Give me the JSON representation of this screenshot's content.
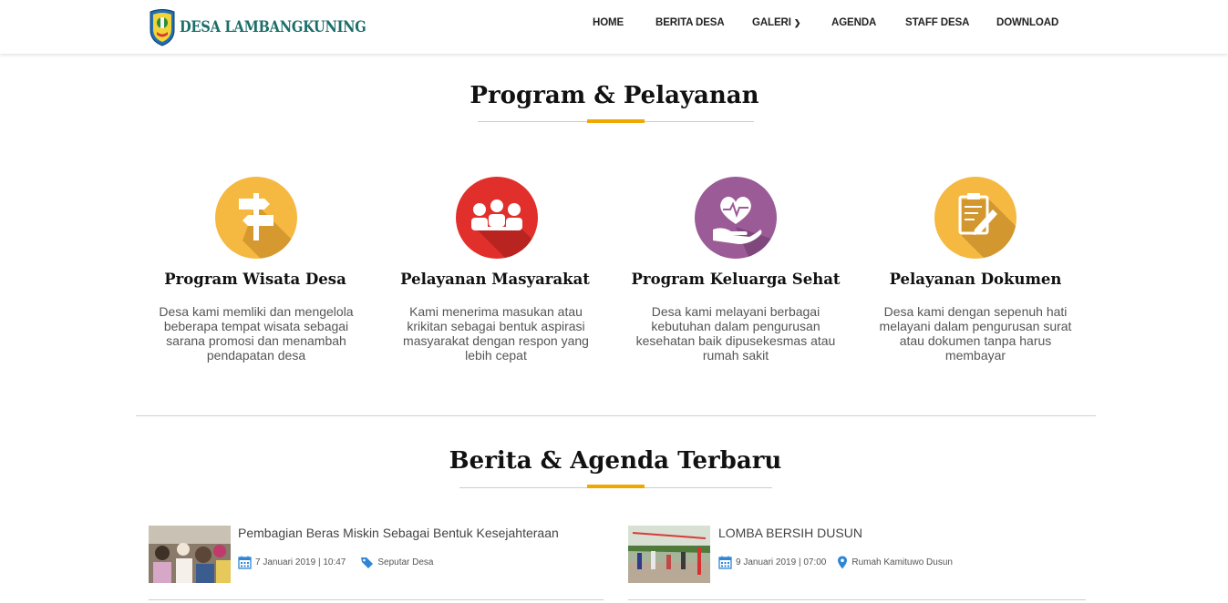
{
  "brand": {
    "name": "DESA LAMBANGKUNING"
  },
  "nav": {
    "home": "HOME",
    "berita": "BERITA DESA",
    "galeri": "GALERI",
    "agenda": "AGENDA",
    "staff": "STAFF DESA",
    "download": "DOWNLOAD"
  },
  "program": {
    "title": "Program & Pelayanan",
    "items": [
      {
        "name": "Program Wisata Desa",
        "desc": "Desa kami memliki dan mengelola beberapa tempat wisata sebagai sarana promosi dan menambah pendapatan desa",
        "icon": "signpost-icon",
        "color": "#f5b942"
      },
      {
        "name": "Pelayanan Masyarakat",
        "desc": "Kami menerima masukan atau krikitan sebagai bentuk aspirasi masyarakat dengan respon yang lebih cepat",
        "icon": "people-meeting-icon",
        "color": "#e1302b"
      },
      {
        "name": "Program Keluarga Sehat",
        "desc": "Desa kami melayani berbagai kebutuhan dalam pengurusan kesehatan baik dipusekesmas atau rumah sakit",
        "icon": "heart-hand-icon",
        "color": "#9b5b96"
      },
      {
        "name": "Pelayanan Dokumen",
        "desc": "Desa kami dengan sepenuh hati melayani dalam pengurusan surat atau dokumen tanpa harus membayar",
        "icon": "document-pen-icon",
        "color": "#f5b942"
      }
    ]
  },
  "news": {
    "title": "Berita & Agenda Terbaru",
    "items": [
      {
        "title": "Pembagian Beras Miskin Sebagai Bentuk Kesejahteraan",
        "date": "7 Januari 2019 | 10:47",
        "tag": "Seputar Desa",
        "tag_icon": "tag-icon"
      },
      {
        "title": "LOMBA BERSIH DUSUN",
        "date": "9 Januari 2019 | 07:00",
        "tag": "Rumah Kamituwo Dusun",
        "tag_icon": "map-pin-icon"
      }
    ]
  },
  "colors": {
    "accent": "#f0a800",
    "brand": "#1b6e6a",
    "meta_icon": "#2f86d6"
  }
}
